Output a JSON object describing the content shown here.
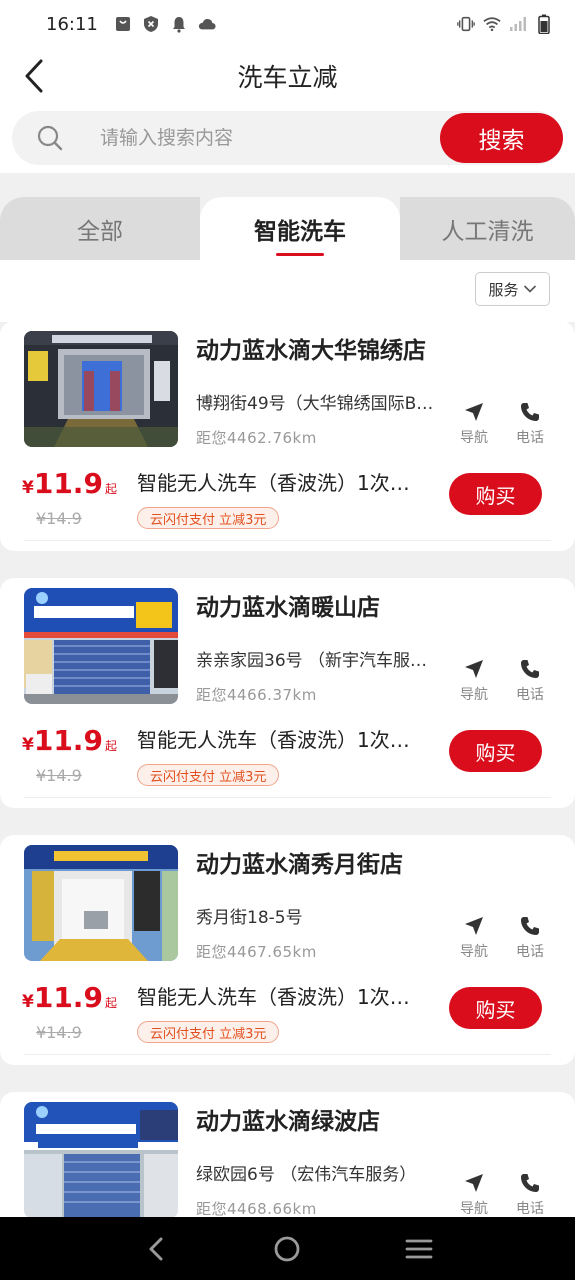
{
  "status_bar": {
    "time": "16:11"
  },
  "header": {
    "title": "洗车立减"
  },
  "search": {
    "placeholder": "请输入搜索内容",
    "button_label": "搜索"
  },
  "tabs": [
    {
      "label": "全部",
      "active": false
    },
    {
      "label": "智能洗车",
      "active": true
    },
    {
      "label": "人工清洗",
      "active": false
    }
  ],
  "filter": {
    "label": "服务"
  },
  "actions": {
    "nav_label": "导航",
    "phone_label": "电话"
  },
  "buy_label": "购买",
  "price_currency": "¥",
  "price_suffix": "起",
  "stores": [
    {
      "name": "动力蓝水滴大华锦绣店",
      "address": "博翔街49号（大华锦绣国际B…",
      "distance": "距您4462.76km",
      "price": "11.9",
      "old_price": "¥14.9",
      "service": "智能无人洗车（香波洗）1次…",
      "promo": "云闪付支付 立减3元"
    },
    {
      "name": "动力蓝水滴暖山店",
      "address": "亲亲家园36号 （新宇汽车服…",
      "distance": "距您4466.37km",
      "price": "11.9",
      "old_price": "¥14.9",
      "service": "智能无人洗车（香波洗）1次…",
      "promo": "云闪付支付 立减3元"
    },
    {
      "name": "动力蓝水滴秀月街店",
      "address": "秀月街18-5号",
      "distance": "距您4467.65km",
      "price": "11.9",
      "old_price": "¥14.9",
      "service": "智能无人洗车（香波洗）1次…",
      "promo": "云闪付支付 立减3元"
    },
    {
      "name": "动力蓝水滴绿波店",
      "address": "绿欧园6号 （宏伟汽车服务）",
      "distance": "距您4468.66km"
    }
  ],
  "colors": {
    "accent": "#d90d1c",
    "promo": "#e2501f"
  },
  "icons": {
    "back": "back-arrow-icon",
    "search": "search-icon",
    "nav": "navigation-arrow-icon",
    "phone": "phone-icon",
    "filter": "chevron-down-icon"
  }
}
